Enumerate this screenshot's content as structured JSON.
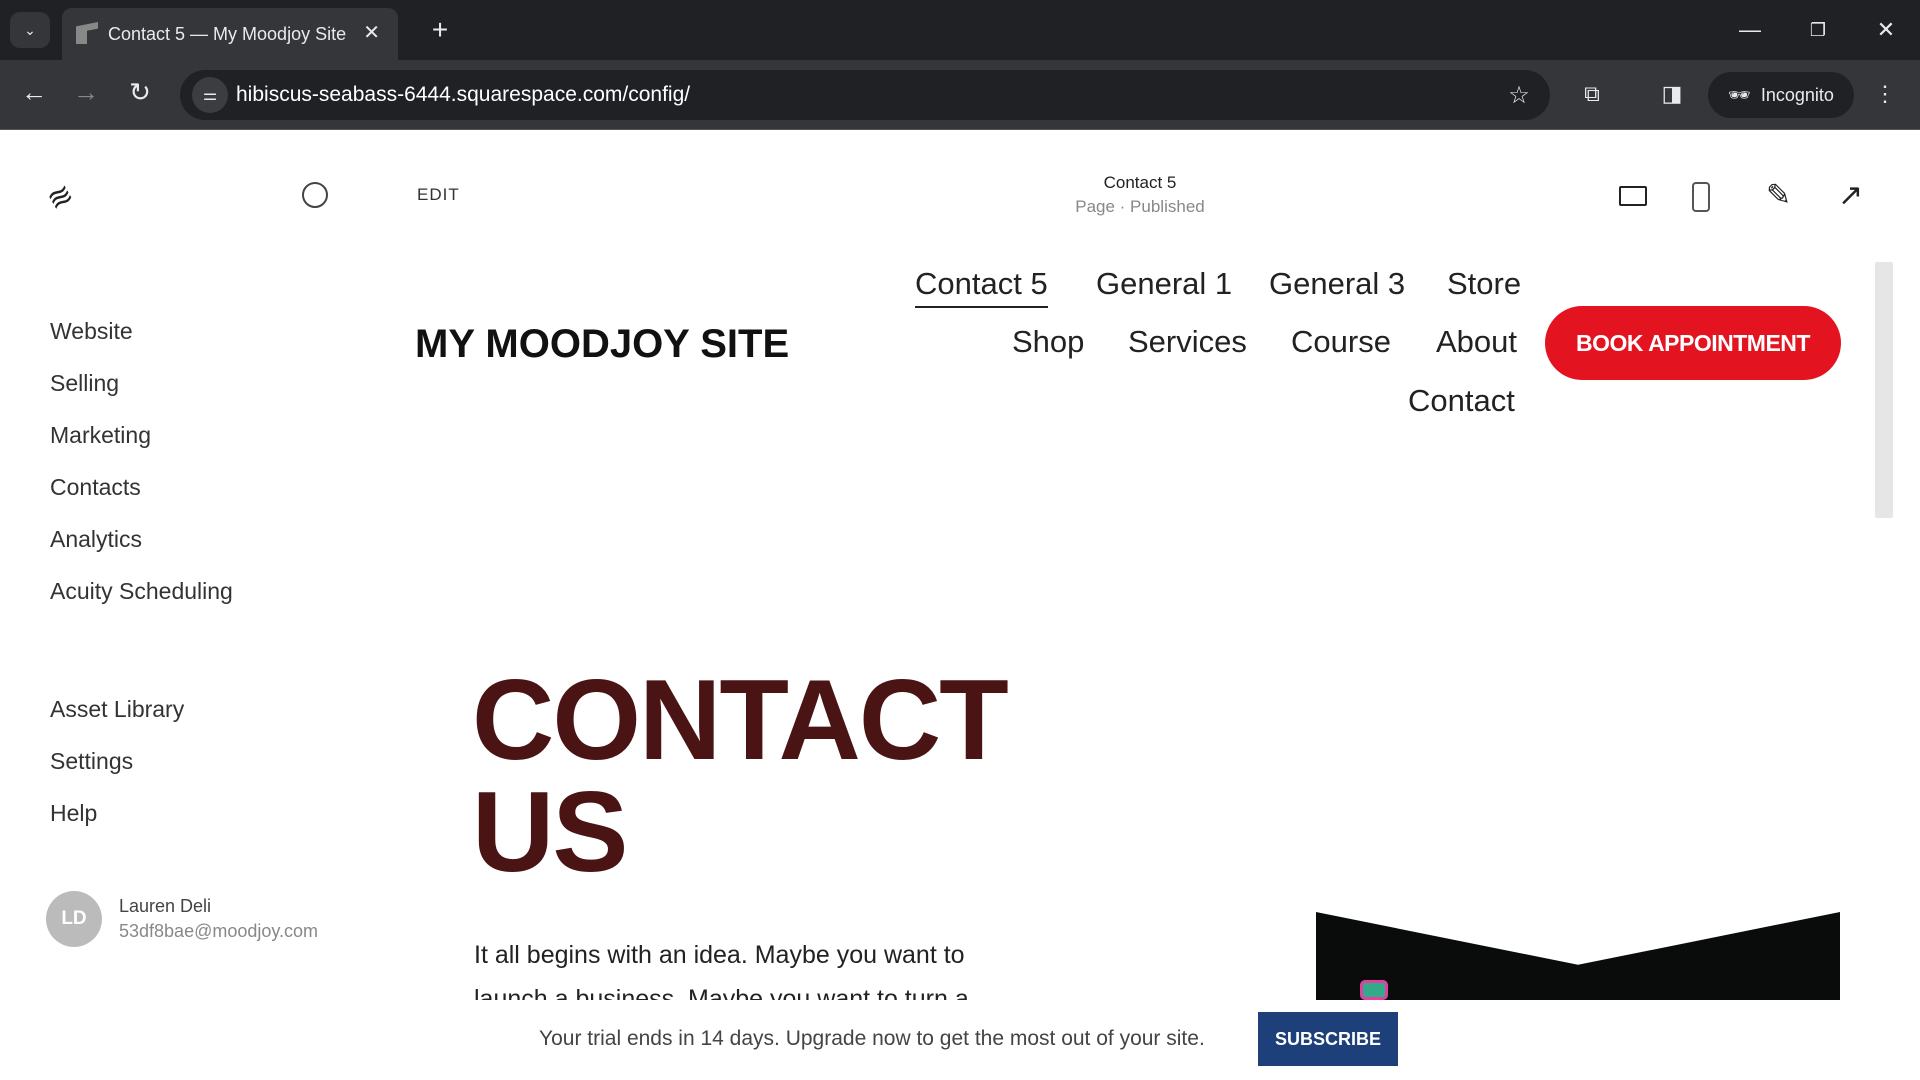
{
  "browser": {
    "tab_title": "Contact 5 — My Moodjoy Site",
    "url": "hibiscus-seabass-6444.squarespace.com/config/",
    "incognito_label": "Incognito"
  },
  "editor": {
    "edit_label": "EDIT",
    "page_title": "Contact 5",
    "page_status": "Page · Published"
  },
  "sidebar": {
    "items": [
      {
        "label": "Website"
      },
      {
        "label": "Selling"
      },
      {
        "label": "Marketing"
      },
      {
        "label": "Contacts"
      },
      {
        "label": "Analytics"
      },
      {
        "label": "Acuity Scheduling"
      }
    ],
    "secondary": [
      {
        "label": "Asset Library"
      },
      {
        "label": "Settings"
      },
      {
        "label": "Help"
      }
    ],
    "user": {
      "initials": "LD",
      "name": "Lauren Deli",
      "email": "53df8bae@moodjoy.com"
    }
  },
  "site": {
    "logo": "MY MOODJOY SITE",
    "nav": [
      "Contact 5",
      "General 1",
      "General 3",
      "Store",
      "Shop",
      "Services",
      "Course",
      "About",
      "Contact"
    ],
    "cta": "BOOK APPOINTMENT",
    "heading_line1": "CONTACT",
    "heading_line2": "US",
    "paragraph_line1": "It all begins with an idea. Maybe you want to",
    "paragraph_line2": "launch a business. Maybe you want to turn a",
    "accent": "#e3141f",
    "heading_color": "#4a1414"
  },
  "banner": {
    "text": "Your trial ends in 14 days. Upgrade now to get the most out of your site.",
    "button": "SUBSCRIBE",
    "button_color": "#1d3f7a"
  }
}
